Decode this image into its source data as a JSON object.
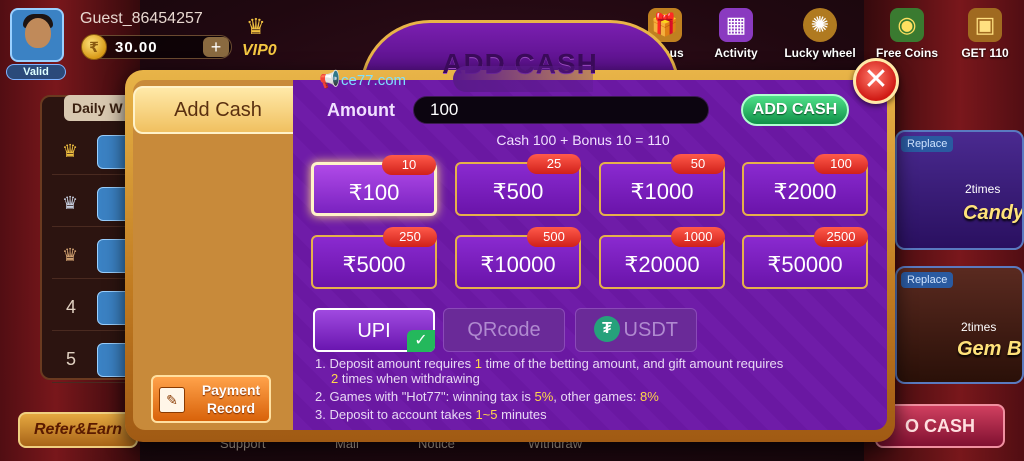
{
  "user": {
    "name": "Guest_86454257",
    "badge": "Valid",
    "balance": "30.00",
    "vip": "VIP0"
  },
  "nav": [
    {
      "label": "Bonus",
      "icon": "gift-icon"
    },
    {
      "label": "Activity",
      "icon": "calendar-icon"
    },
    {
      "label": "Lucky wheel",
      "icon": "wheel-icon"
    },
    {
      "label": "Free Coins",
      "icon": "coins-icon"
    },
    {
      "label": "GET  110",
      "icon": "chest-icon"
    }
  ],
  "lobby": {
    "daily_title": "Daily W",
    "ranks": [
      "4",
      "5"
    ],
    "refer_label": "Refer&Earn",
    "bottom_labels": [
      "Support",
      "Mail",
      "Notice",
      "Withdraw"
    ],
    "cards": [
      {
        "tag": "Replace",
        "times": "2times",
        "title": "Candy"
      },
      {
        "tag": "Replace",
        "times": "2times",
        "title": "Gem B"
      }
    ],
    "cash_button": "O CASH"
  },
  "modal": {
    "heading": "ADD CASH",
    "marquee": "ce77.com",
    "tab_label": "Add Cash",
    "payment_record_label": "Payment Record",
    "amount_label": "Amount",
    "amount_value": "100",
    "add_cash_label": "ADD CASH",
    "bonus_line": "Cash 100 + Bonus 10 = 110",
    "amounts": [
      {
        "value": "₹100",
        "bonus": "10",
        "selected": true
      },
      {
        "value": "₹500",
        "bonus": "25",
        "selected": false
      },
      {
        "value": "₹1000",
        "bonus": "50",
        "selected": false
      },
      {
        "value": "₹2000",
        "bonus": "100",
        "selected": false
      },
      {
        "value": "₹5000",
        "bonus": "250",
        "selected": false
      },
      {
        "value": "₹10000",
        "bonus": "500",
        "selected": false
      },
      {
        "value": "₹20000",
        "bonus": "1000",
        "selected": false
      },
      {
        "value": "₹50000",
        "bonus": "2500",
        "selected": false
      }
    ],
    "payment_methods": [
      {
        "label": "UPI",
        "selected": true
      },
      {
        "label": "QRcode",
        "selected": false
      },
      {
        "label": "USDT",
        "selected": false
      }
    ],
    "notes": {
      "n1_a": "1. Deposit amount requires ",
      "n1_b": "1",
      "n1_c": " time of the betting amount, and gift amount requires",
      "n1_d": "2",
      "n1_e": " times when withdrawing",
      "n2_a": "2. Games with \"Hot77\": winning tax is ",
      "n2_b": "5%",
      "n2_c": ", other games: ",
      "n2_d": "8%",
      "n3_a": "3. Deposit to account takes ",
      "n3_b": "1~5",
      "n3_c": " minutes"
    }
  },
  "colors": {
    "accent_gold": "#e8b448",
    "panel_purple": "#6f1ca8",
    "highlight_yellow": "#ffd84a",
    "success_green": "#24b85c",
    "close_red": "#d01a14"
  }
}
